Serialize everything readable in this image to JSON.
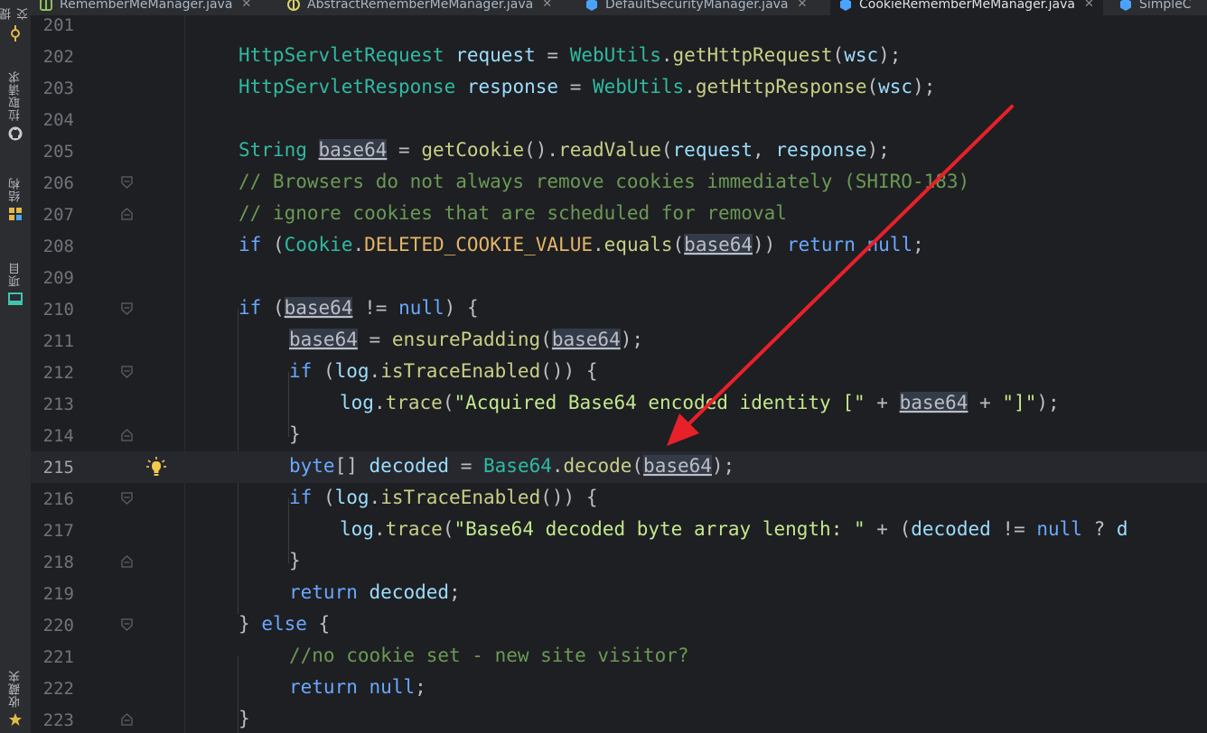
{
  "tabs": [
    {
      "label": "RememberMeManager.java",
      "color": "#8fbf5a"
    },
    {
      "label": "AbstractRememberMeManager.java",
      "color": "#dcd26e"
    },
    {
      "label": "DefaultSecurityManager.java",
      "color": "#4aa3ff"
    },
    {
      "label": "CookieRememberMeManager.java",
      "color": "#4aa3ff",
      "active": true
    },
    {
      "label": "SimpleC",
      "color": "#4aa3ff"
    }
  ],
  "toolstrip": {
    "commit": "提交",
    "pull_requests": "拉取请求",
    "structure": "结构",
    "project": "项目",
    "favorites": "收藏夹"
  },
  "editor": {
    "current_line": "215",
    "lines": [
      {
        "n": "201",
        "text": ""
      },
      {
        "n": "202",
        "text": "HttpServletRequest request = WebUtils.getHttpRequest(wsc);"
      },
      {
        "n": "203",
        "text": "HttpServletResponse response = WebUtils.getHttpResponse(wsc);"
      },
      {
        "n": "204",
        "text": ""
      },
      {
        "n": "205",
        "text": "String base64 = getCookie().readValue(request, response);"
      },
      {
        "n": "206",
        "text": "// Browsers do not always remove cookies immediately (SHIRO-183)"
      },
      {
        "n": "207",
        "text": "// ignore cookies that are scheduled for removal"
      },
      {
        "n": "208",
        "text": "if (Cookie.DELETED_COOKIE_VALUE.equals(base64)) return null;"
      },
      {
        "n": "209",
        "text": ""
      },
      {
        "n": "210",
        "text": "if (base64 != null) {"
      },
      {
        "n": "211",
        "text": "base64 = ensurePadding(base64);"
      },
      {
        "n": "212",
        "text": "if (log.isTraceEnabled()) {"
      },
      {
        "n": "213",
        "text": "log.trace(\"Acquired Base64 encoded identity [\" + base64 + \"]\");"
      },
      {
        "n": "214",
        "text": "}"
      },
      {
        "n": "215",
        "text": "byte[] decoded = Base64.decode(base64);"
      },
      {
        "n": "216",
        "text": "if (log.isTraceEnabled()) {"
      },
      {
        "n": "217",
        "text": "log.trace(\"Base64 decoded byte array length: \" + (decoded != null ? d"
      },
      {
        "n": "218",
        "text": "}"
      },
      {
        "n": "219",
        "text": "return decoded;"
      },
      {
        "n": "220",
        "text": "} else {"
      },
      {
        "n": "221",
        "text": "//no cookie set - new site visitor?"
      },
      {
        "n": "222",
        "text": "return null;"
      },
      {
        "n": "223",
        "text": "}"
      }
    ]
  },
  "annotation": {
    "color": "#e8202a"
  }
}
